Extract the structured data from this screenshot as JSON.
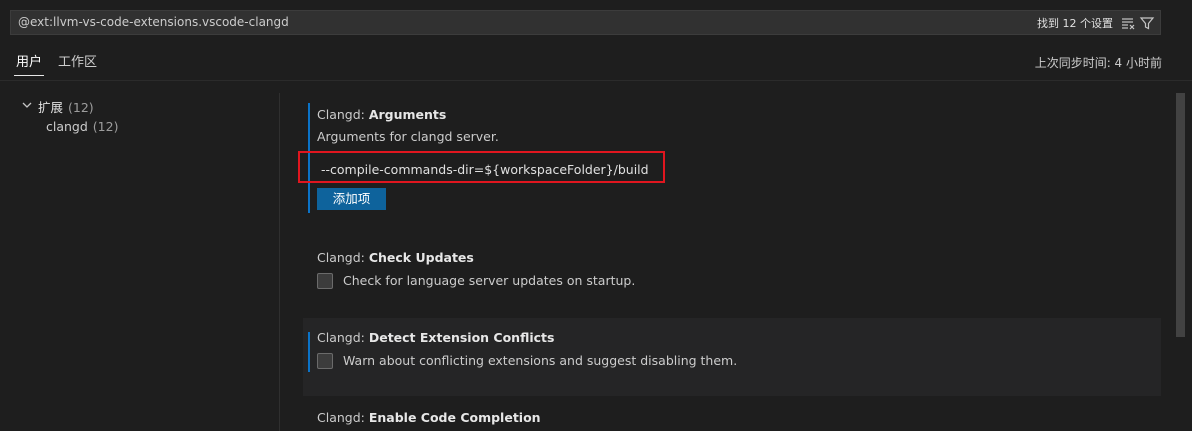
{
  "search": {
    "query": "@ext:llvm-vs-code-extensions.vscode-clangd",
    "result_count": "找到 12 个设置"
  },
  "tabs": [
    {
      "label": "用户",
      "active": true
    },
    {
      "label": "工作区",
      "active": false
    }
  ],
  "sync_status": "上次同步时间: 4 小时前",
  "toc": {
    "group": {
      "label": "扩展",
      "count": "(12)"
    },
    "child": {
      "label": "clangd",
      "count": "(12)"
    }
  },
  "settings": [
    {
      "category": "Clangd: ",
      "name": "Arguments",
      "description": "Arguments for clangd server.",
      "list_value": "--compile-commands-dir=${workspaceFolder}/build",
      "add_button": "添加项"
    },
    {
      "category": "Clangd: ",
      "name": "Check Updates",
      "checkbox_label": "Check for language server updates on startup.",
      "checked": false
    },
    {
      "category": "Clangd: ",
      "name": "Detect Extension Conflicts",
      "checkbox_label": "Warn about conflicting extensions and suggest disabling them.",
      "checked": false
    },
    {
      "category": "Clangd: ",
      "name": "Enable Code Completion"
    }
  ],
  "colors": {
    "accent": "#0e639c",
    "modified_indicator": "#0b73c8",
    "highlight_box": "#e0161f"
  },
  "icons": [
    "clear-filter-icon",
    "filter-icon",
    "chevron-down-icon"
  ]
}
